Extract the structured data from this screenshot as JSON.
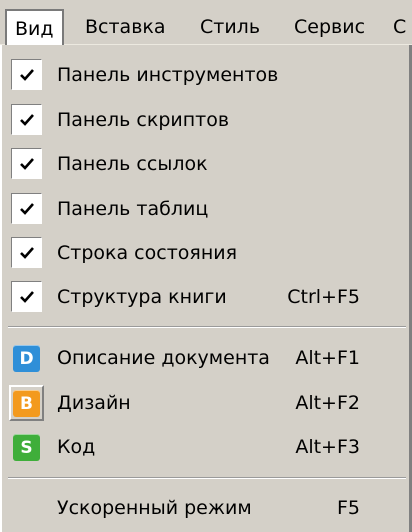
{
  "menubar": {
    "items": [
      {
        "label": "Вид"
      },
      {
        "label": "Вставка"
      },
      {
        "label": "Стиль"
      },
      {
        "label": "Сервис"
      },
      {
        "label": "С"
      }
    ]
  },
  "menu": {
    "panel_items": [
      {
        "label": "Панель инструментов",
        "checked": true
      },
      {
        "label": "Панель скриптов",
        "checked": true
      },
      {
        "label": "Панель ссылок",
        "checked": true
      },
      {
        "label": "Панель таблиц",
        "checked": true
      },
      {
        "label": "Строка состояния",
        "checked": true
      },
      {
        "label": "Структура книги",
        "shortcut": "Ctrl+F5",
        "checked": true
      }
    ],
    "mode_items": [
      {
        "label": "Описание документа",
        "shortcut": "Alt+F1",
        "icon": "D",
        "icon_color": "#2f8fd8"
      },
      {
        "label": "Дизайн",
        "shortcut": "Alt+F2",
        "icon": "B",
        "icon_color": "#f39a1e",
        "selected": true
      },
      {
        "label": "Код",
        "shortcut": "Alt+F3",
        "icon": "S",
        "icon_color": "#3fae3a"
      }
    ],
    "fast_mode": {
      "label": "Ускоренный режим",
      "shortcut": "F5"
    }
  }
}
